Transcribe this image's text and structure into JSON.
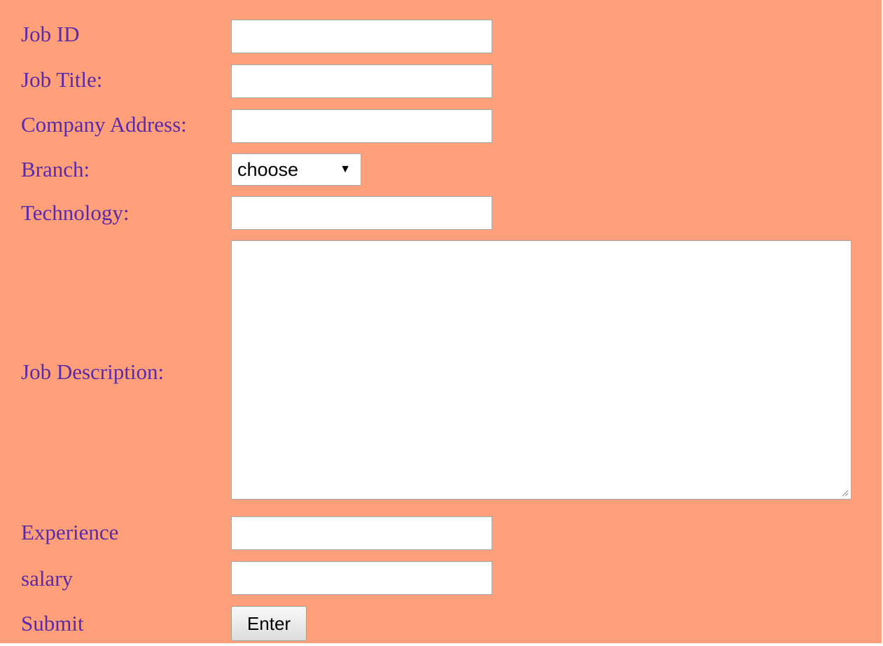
{
  "form": {
    "job_id": {
      "label": "Job ID",
      "value": ""
    },
    "job_title": {
      "label": "Job Title:",
      "value": ""
    },
    "company_address": {
      "label": "Company Address:",
      "value": ""
    },
    "branch": {
      "label": "Branch:",
      "selected": "choose"
    },
    "technology": {
      "label": "Technology:",
      "value": ""
    },
    "job_description": {
      "label": "Job Description:",
      "value": ""
    },
    "experience": {
      "label": "Experience",
      "value": ""
    },
    "salary": {
      "label": "salary",
      "value": ""
    },
    "submit": {
      "label": "Submit",
      "button_label": "Enter"
    }
  },
  "colors": {
    "background": "#ffa07a",
    "label_text": "#5b2aa6",
    "field_border": "#a9a9a9"
  }
}
